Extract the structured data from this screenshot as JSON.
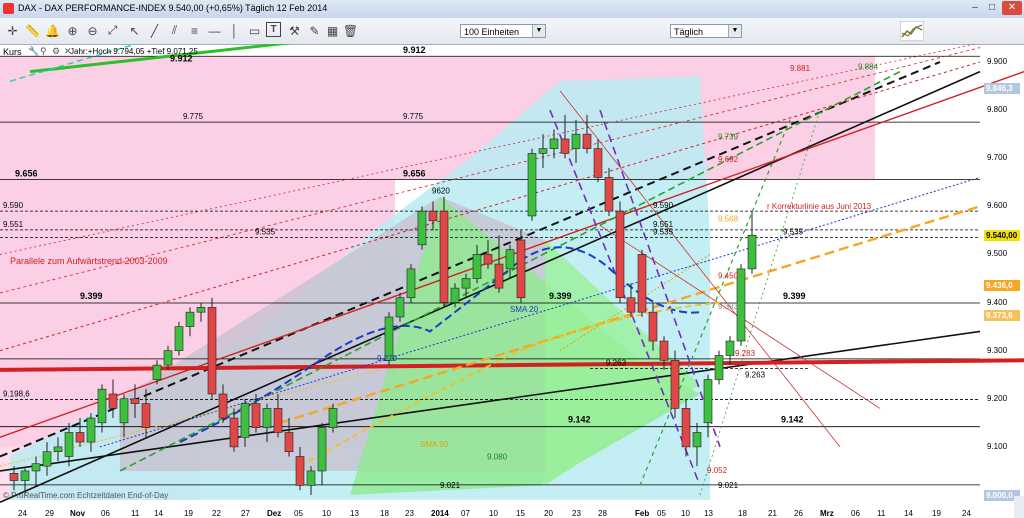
{
  "window": {
    "title": "DAX - DAX PERFORMANCE-INDEX    9.540,00 (+0,65%)   Täglich  12 Feb 2014",
    "buttons": [
      "–",
      "□",
      "✕"
    ]
  },
  "toolbar": {
    "icons": [
      "crosshair-icon",
      "ruler-icon",
      "bell-icon",
      "zoom-in-icon",
      "zoom-out-icon",
      "fit-icon",
      "cursor-icon",
      "trendline-icon",
      "channel-icon",
      "fibonacci-icon",
      "text-icon",
      "pencil-icon",
      "shapes-icon",
      "calendar-icon",
      "trash-icon"
    ],
    "units_select": "100 Einheiten",
    "interval_select": "Täglich"
  },
  "kurs": {
    "label": "Kurs",
    "info": "Jahr:+Hoch 9.794,05 +Tief 9.071,25"
  },
  "y_axis": {
    "ticks": [
      "9.900",
      "9.800",
      "9.700",
      "9.600",
      "9.500",
      "9.400",
      "9.300",
      "9.200",
      "9.100",
      "9.000"
    ],
    "price_boxes": [
      {
        "label": "9.846,3",
        "color": "#b3c7e0",
        "text_color": "#fff",
        "value": 9846
      },
      {
        "label": "9.540,00",
        "color": "#f3e400",
        "text_color": "#000",
        "value": 9540
      },
      {
        "label": "9.436,0",
        "color": "#f5a623",
        "text_color": "#fff",
        "value": 9436
      },
      {
        "label": "9.373,6",
        "color": "#f5c25a",
        "text_color": "#fff",
        "value": 9374
      },
      {
        "label": "9.000,0",
        "color": "#b3c7e0",
        "text_color": "#fff",
        "value": 9001
      }
    ]
  },
  "x_axis": {
    "labels": [
      "24",
      "29",
      "Nov",
      "06",
      "11",
      "14",
      "19",
      "22",
      "27",
      "Dez",
      "05",
      "10",
      "13",
      "18",
      "23",
      "2014",
      "07",
      "10",
      "15",
      "20",
      "23",
      "28",
      "Feb",
      "05",
      "10",
      "13",
      "18",
      "21",
      "26",
      "Mrz",
      "06",
      "11",
      "14",
      "19",
      "24"
    ]
  },
  "annotations": {
    "left_levels": [
      {
        "text": "9.656",
        "bold": true
      },
      {
        "text": "9.590",
        "bold": false
      },
      {
        "text": "9.551",
        "bold": false
      },
      {
        "text": "9.399",
        "bold": true
      },
      {
        "text": "9.198,6",
        "bold": false
      },
      {
        "text": "9.912",
        "bold": true
      }
    ],
    "levels": [
      {
        "text": "9.912",
        "bold": true
      },
      {
        "text": "9.775",
        "bold": false
      },
      {
        "text": "9.775",
        "bold": false
      },
      {
        "text": "9.656",
        "bold": true
      },
      {
        "text": "9620",
        "bold": false
      },
      {
        "text": "9.590",
        "bold": false
      },
      {
        "text": "9.551",
        "bold": false
      },
      {
        "text": "9.535",
        "bold": false
      },
      {
        "text": "9.535",
        "bold": false
      },
      {
        "text": "9.535",
        "bold": false
      },
      {
        "text": "9.399",
        "bold": true
      },
      {
        "text": "9.399",
        "bold": true
      },
      {
        "text": "9.393",
        "bold": false
      },
      {
        "text": "9.283",
        "bold": false
      },
      {
        "text": "9.263",
        "bold": false
      },
      {
        "text": "9.263",
        "bold": false
      },
      {
        "text": "9.142",
        "bold": true
      },
      {
        "text": "9.142",
        "bold": true
      },
      {
        "text": "9.080",
        "bold": false
      },
      {
        "text": "9.052",
        "bold": false
      },
      {
        "text": "9.021",
        "bold": false
      },
      {
        "text": "9.021",
        "bold": false
      },
      {
        "text": "9.279",
        "bold": false
      },
      {
        "text": "9.881",
        "bold": false
      },
      {
        "text": "9.884",
        "bold": false
      },
      {
        "text": "9.739",
        "bold": false
      },
      {
        "text": "9.692",
        "bold": false
      },
      {
        "text": "9.568",
        "bold": false
      },
      {
        "text": "9.450",
        "bold": false
      }
    ],
    "notes": [
      {
        "text": "Parallele zum Aufwärtstrend 2003-2009",
        "color": "#d42020"
      },
      {
        "text": "r Korrekturlinie aus Juni 2013",
        "color": "#d42020"
      },
      {
        "text": "SMA 20",
        "color": "#1a3cc8"
      },
      {
        "text": "SMA 50",
        "color": "#e0a000"
      },
      {
        "text": "© ProRealTime.com Echtzeitdaten End-of-Day",
        "color": "#555"
      }
    ]
  },
  "chart_data": {
    "type": "candlestick",
    "title": "DAX - DAX PERFORMANCE-INDEX",
    "interval": "Täglich",
    "last": 9540.0,
    "change_pct": "+0,65%",
    "ylim": [
      8990,
      9940
    ],
    "candles": [
      {
        "o": 9045,
        "h": 9060,
        "l": 9010,
        "c": 9030
      },
      {
        "o": 9030,
        "h": 9055,
        "l": 9000,
        "c": 9050
      },
      {
        "o": 9050,
        "h": 9080,
        "l": 9020,
        "c": 9065
      },
      {
        "o": 9060,
        "h": 9110,
        "l": 9040,
        "c": 9090
      },
      {
        "o": 9090,
        "h": 9120,
        "l": 9070,
        "c": 9100
      },
      {
        "o": 9080,
        "h": 9150,
        "l": 9060,
        "c": 9130
      },
      {
        "o": 9130,
        "h": 9160,
        "l": 9100,
        "c": 9110
      },
      {
        "o": 9110,
        "h": 9170,
        "l": 9090,
        "c": 9160
      },
      {
        "o": 9150,
        "h": 9230,
        "l": 9130,
        "c": 9220
      },
      {
        "o": 9210,
        "h": 9240,
        "l": 9160,
        "c": 9180
      },
      {
        "o": 9150,
        "h": 9210,
        "l": 9120,
        "c": 9200
      },
      {
        "o": 9200,
        "h": 9230,
        "l": 9160,
        "c": 9190
      },
      {
        "o": 9190,
        "h": 9220,
        "l": 9120,
        "c": 9140
      },
      {
        "o": 9240,
        "h": 9280,
        "l": 9230,
        "c": 9270
      },
      {
        "o": 9270,
        "h": 9310,
        "l": 9260,
        "c": 9300
      },
      {
        "o": 9300,
        "h": 9360,
        "l": 9290,
        "c": 9350
      },
      {
        "o": 9350,
        "h": 9390,
        "l": 9330,
        "c": 9380
      },
      {
        "o": 9380,
        "h": 9400,
        "l": 9360,
        "c": 9390
      },
      {
        "o": 9390,
        "h": 9410,
        "l": 9200,
        "c": 9210
      },
      {
        "o": 9210,
        "h": 9230,
        "l": 9150,
        "c": 9160
      },
      {
        "o": 9160,
        "h": 9180,
        "l": 9090,
        "c": 9100
      },
      {
        "o": 9120,
        "h": 9200,
        "l": 9100,
        "c": 9190
      },
      {
        "o": 9190,
        "h": 9210,
        "l": 9130,
        "c": 9140
      },
      {
        "o": 9140,
        "h": 9190,
        "l": 9110,
        "c": 9180
      },
      {
        "o": 9180,
        "h": 9210,
        "l": 9120,
        "c": 9130
      },
      {
        "o": 9130,
        "h": 9160,
        "l": 9080,
        "c": 9090
      },
      {
        "o": 9080,
        "h": 9100,
        "l": 9010,
        "c": 9020
      },
      {
        "o": 9020,
        "h": 9060,
        "l": 9000,
        "c": 9050
      },
      {
        "o": 9050,
        "h": 9150,
        "l": 9020,
        "c": 9140
      },
      {
        "o": 9140,
        "h": 9190,
        "l": 9130,
        "c": 9180
      },
      {
        "o": 9280,
        "h": 9380,
        "l": 9270,
        "c": 9370
      },
      {
        "o": 9370,
        "h": 9420,
        "l": 9360,
        "c": 9410
      },
      {
        "o": 9410,
        "h": 9480,
        "l": 9400,
        "c": 9470
      },
      {
        "o": 9520,
        "h": 9600,
        "l": 9510,
        "c": 9590
      },
      {
        "o": 9590,
        "h": 9610,
        "l": 9550,
        "c": 9570
      },
      {
        "o": 9590,
        "h": 9620,
        "l": 9390,
        "c": 9400
      },
      {
        "o": 9400,
        "h": 9440,
        "l": 9390,
        "c": 9430
      },
      {
        "o": 9430,
        "h": 9460,
        "l": 9410,
        "c": 9450
      },
      {
        "o": 9450,
        "h": 9520,
        "l": 9440,
        "c": 9500
      },
      {
        "o": 9500,
        "h": 9530,
        "l": 9470,
        "c": 9480
      },
      {
        "o": 9480,
        "h": 9540,
        "l": 9420,
        "c": 9430
      },
      {
        "o": 9470,
        "h": 9520,
        "l": 9450,
        "c": 9510
      },
      {
        "o": 9530,
        "h": 9550,
        "l": 9400,
        "c": 9410
      },
      {
        "o": 9580,
        "h": 9720,
        "l": 9570,
        "c": 9710
      },
      {
        "o": 9710,
        "h": 9750,
        "l": 9680,
        "c": 9720
      },
      {
        "o": 9720,
        "h": 9760,
        "l": 9700,
        "c": 9740
      },
      {
        "o": 9740,
        "h": 9790,
        "l": 9700,
        "c": 9710
      },
      {
        "o": 9720,
        "h": 9780,
        "l": 9690,
        "c": 9750
      },
      {
        "o": 9750,
        "h": 9790,
        "l": 9710,
        "c": 9720
      },
      {
        "o": 9720,
        "h": 9740,
        "l": 9650,
        "c": 9660
      },
      {
        "o": 9660,
        "h": 9680,
        "l": 9580,
        "c": 9590
      },
      {
        "o": 9590,
        "h": 9610,
        "l": 9400,
        "c": 9410
      },
      {
        "o": 9410,
        "h": 9440,
        "l": 9370,
        "c": 9380
      },
      {
        "o": 9500,
        "h": 9510,
        "l": 9370,
        "c": 9380
      },
      {
        "o": 9380,
        "h": 9400,
        "l": 9300,
        "c": 9320
      },
      {
        "o": 9320,
        "h": 9330,
        "l": 9260,
        "c": 9280
      },
      {
        "o": 9280,
        "h": 9300,
        "l": 9160,
        "c": 9180
      },
      {
        "o": 9180,
        "h": 9200,
        "l": 9080,
        "c": 9100
      },
      {
        "o": 9100,
        "h": 9150,
        "l": 9060,
        "c": 9130
      },
      {
        "o": 9150,
        "h": 9250,
        "l": 9120,
        "c": 9240
      },
      {
        "o": 9240,
        "h": 9300,
        "l": 9230,
        "c": 9290
      },
      {
        "o": 9290,
        "h": 9330,
        "l": 9270,
        "c": 9320
      },
      {
        "o": 9320,
        "h": 9480,
        "l": 9310,
        "c": 9470
      },
      {
        "o": 9470,
        "h": 9590,
        "l": 9460,
        "c": 9540
      }
    ],
    "horizontal_levels": [
      9912,
      9775,
      9656,
      9590,
      9551,
      9535,
      9399,
      9283,
      9263,
      9198.6,
      9142,
      9021
    ],
    "series": [
      {
        "name": "SMA 20",
        "color": "#1a3cc8"
      },
      {
        "name": "SMA 50",
        "color": "#e0a000"
      }
    ],
    "grid": false
  },
  "colors": {
    "bull": "#3fbf3f",
    "bear": "#e04848",
    "pink_zone": "#fbd0e6",
    "cyan_zone": "#b8ecf2",
    "green_zone": "#8fea8f",
    "grey_zone": "#c8c0d0",
    "red_line": "#d42020",
    "black_line": "#111111",
    "blue_dash": "#1a3cc8",
    "orange_dash": "#f5a623",
    "green_dash": "#2aa02a"
  }
}
